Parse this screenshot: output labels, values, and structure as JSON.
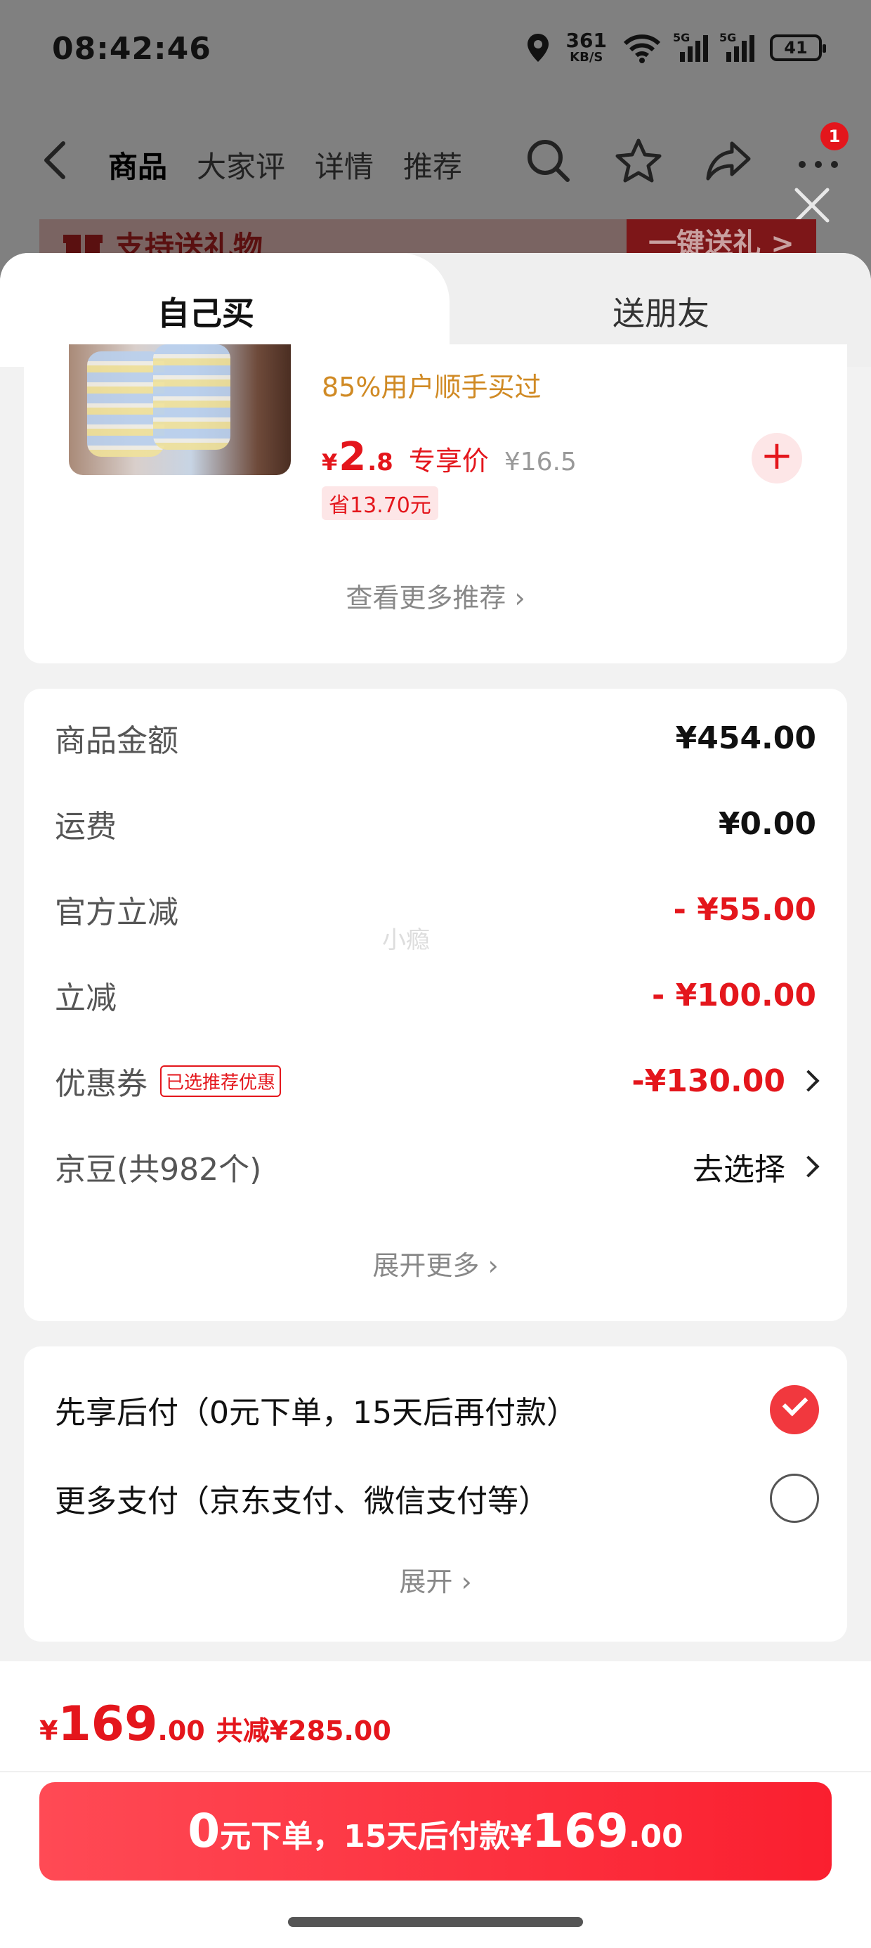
{
  "status_bar": {
    "time": "08:42:46",
    "net_speed_value": "361",
    "net_speed_unit": "KB/S",
    "signal1_label": "5G",
    "signal2_label": "5G",
    "battery": "41",
    "icons": [
      "location-icon",
      "wifi-icon",
      "signal-icon",
      "battery-icon"
    ]
  },
  "nav": {
    "tabs": [
      "商品",
      "大家评",
      "详情",
      "推荐"
    ],
    "active_tab": "商品",
    "badge_count": "1",
    "icons": [
      "back-icon",
      "search-icon",
      "star-icon",
      "share-icon",
      "more-icon",
      "close-icon"
    ]
  },
  "gift_bar": {
    "text": "支持送礼物",
    "button": "一键送礼 >"
  },
  "sheet_tabs": {
    "self": "自己买",
    "friend": "送朋友"
  },
  "recommend": {
    "subtitle": "85%用户顺手买过",
    "currency": "¥",
    "price_int": "2",
    "price_dec": ".8",
    "price_tag": "专享价",
    "original_price": "¥16.5",
    "save_tag": "省13.70元",
    "add_label": "+",
    "more_label": "查看更多推荐 ›"
  },
  "summary": {
    "rows": [
      {
        "label": "商品金额",
        "value": "¥454.00"
      },
      {
        "label": "运费",
        "value": "¥0.00"
      },
      {
        "label": "官方立减",
        "value": "- ¥55.00"
      },
      {
        "label": "立减",
        "value": "- ¥100.00"
      },
      {
        "label": "优惠券",
        "tag": "已选推荐优惠",
        "value": "-¥130.00"
      },
      {
        "label": "京豆(共982个)",
        "value": "去选择"
      }
    ],
    "watermark": "小瘾",
    "expand_label": "展开更多 ›"
  },
  "payment": {
    "options": [
      {
        "label": "先享后付（0元下单，15天后再付款）",
        "selected": true
      },
      {
        "label": "更多支付（京东支付、微信支付等）",
        "selected": false
      }
    ],
    "expand_label": "展开 ›"
  },
  "footer": {
    "currency": "¥",
    "total_int": "169",
    "total_dec": ".00",
    "saved": "共减¥285.00",
    "submit_a": "0",
    "submit_b": "元下单，15天后付款¥",
    "submit_c": "169",
    "submit_d": ".00"
  },
  "colors": {
    "accent": "#e4161c",
    "coupon_orange": "#d08a24",
    "button_gradient_start": "#ff4a55",
    "button_gradient_end": "#fa1f2f"
  }
}
